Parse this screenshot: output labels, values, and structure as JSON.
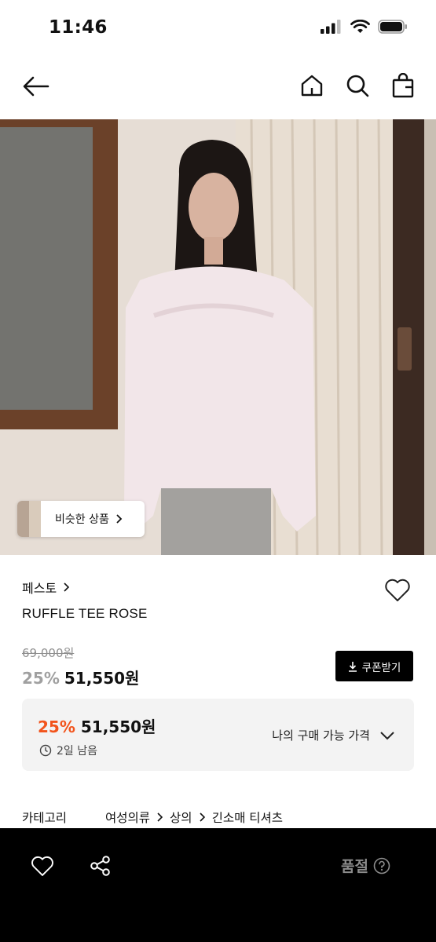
{
  "status_bar": {
    "time": "11:46"
  },
  "nav": {
    "back_icon": "arrow-left-icon",
    "home_icon": "home-icon",
    "search_icon": "search-icon",
    "bag_icon": "shopping-bag-icon"
  },
  "product_image": {
    "similar_button_label": "비슷한 상품"
  },
  "product": {
    "brand": "페스토",
    "name": "RUFFLE TEE ROSE",
    "original_price": "69,000원",
    "discount": "25%",
    "price": "51,550원"
  },
  "coupon_button": {
    "label": "쿠폰받기"
  },
  "my_price": {
    "discount": "25%",
    "price": "51,550원",
    "time_left": "2일 남음",
    "link_label": "나의 구매 가능 가격"
  },
  "category": {
    "label": "카테고리",
    "path": [
      "여성의류",
      "상의",
      "긴소매 티셔츠"
    ]
  },
  "bottom_bar": {
    "status_label": "품절"
  },
  "colors": {
    "accent_discount": "#f2541c",
    "bottom_bar_bg": "#000000",
    "price_box_bg": "#f3f3f3"
  }
}
